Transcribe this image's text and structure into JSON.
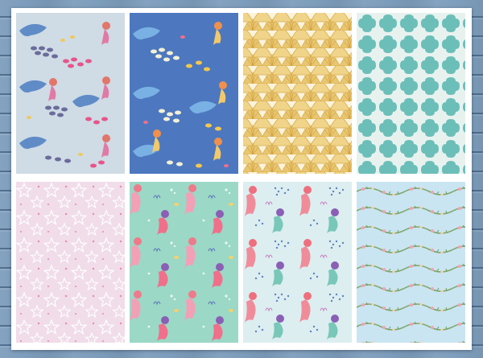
{
  "sheet": {
    "tiles": [
      {
        "pattern": "mermaid-dolphin-fish",
        "background": "#cfdbe5"
      },
      {
        "pattern": "mermaid-dolphin-fish",
        "background": "#4d78bf"
      },
      {
        "pattern": "scallop-shells",
        "background": "#fbf3dc"
      },
      {
        "pattern": "moroccan-quatrefoil",
        "background": "#e7f2ef"
      },
      {
        "pattern": "starfish",
        "background": "#f0dde9"
      },
      {
        "pattern": "mermaids",
        "background": "#9bd8c6"
      },
      {
        "pattern": "mermaids",
        "background": "#dceef0"
      },
      {
        "pattern": "seaweed-garland",
        "background": "#c9e5f2"
      }
    ]
  },
  "colors": {
    "wood": "#7d9dbc",
    "paper": "#ffffff",
    "shell_gold": "#e8c672",
    "quatrefoil_teal": "#6cbfb9",
    "mermaid_pink": "#ef7a8a",
    "fish_pink": "#e8548a"
  }
}
